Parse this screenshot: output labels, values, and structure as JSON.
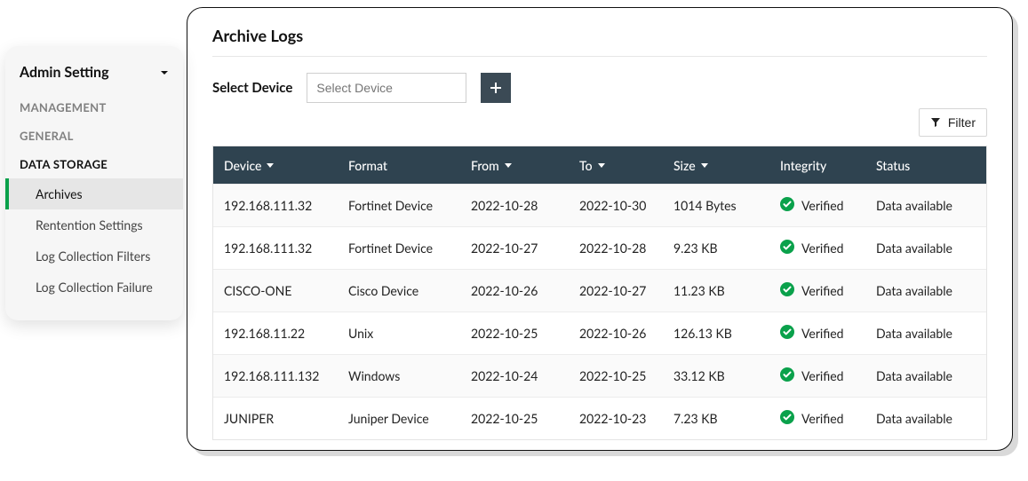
{
  "sidebar": {
    "title": "Admin Setting",
    "sections": [
      {
        "label": "MANAGEMENT",
        "active": false
      },
      {
        "label": "GENERAL",
        "active": false
      },
      {
        "label": "DATA STORAGE",
        "active": true
      }
    ],
    "items": [
      {
        "label": "Archives",
        "active": true
      },
      {
        "label": "Rentention Settings",
        "active": false
      },
      {
        "label": "Log Collection Filters",
        "active": false
      },
      {
        "label": "Log Collection Failure",
        "active": false
      }
    ]
  },
  "page": {
    "title": "Archive Logs",
    "select_device_label": "Select Device",
    "select_device_placeholder": "Select Device",
    "filter_label": "Filter"
  },
  "table": {
    "headers": {
      "device": "Device",
      "format": "Format",
      "from": "From",
      "to": "To",
      "size": "Size",
      "integrity": "Integrity",
      "status": "Status"
    },
    "rows": [
      {
        "device": "192.168.111.32",
        "format": "Fortinet Device",
        "from": "2022-10-28",
        "to": "2022-10-30",
        "size": "1014 Bytes",
        "integrity": "Verified",
        "status": "Data available"
      },
      {
        "device": "192.168.111.32",
        "format": "Fortinet Device",
        "from": "2022-10-27",
        "to": "2022-10-28",
        "size": "9.23 KB",
        "integrity": "Verified",
        "status": "Data available"
      },
      {
        "device": "CISCO-ONE",
        "format": "Cisco Device",
        "from": "2022-10-26",
        "to": "2022-10-27",
        "size": "11.23 KB",
        "integrity": "Verified",
        "status": "Data available"
      },
      {
        "device": "192.168.11.22",
        "format": "Unix",
        "from": "2022-10-25",
        "to": "2022-10-26",
        "size": "126.13 KB",
        "integrity": "Verified",
        "status": "Data available"
      },
      {
        "device": "192.168.111.132",
        "format": "Windows",
        "from": "2022-10-24",
        "to": "2022-10-25",
        "size": "33.12 KB",
        "integrity": "Verified",
        "status": "Data available"
      },
      {
        "device": "JUNIPER",
        "format": "Juniper Device",
        "from": "2022-10-25",
        "to": "2022-10-23",
        "size": "7.23 KB",
        "integrity": "Verified",
        "status": "Data available"
      }
    ]
  }
}
